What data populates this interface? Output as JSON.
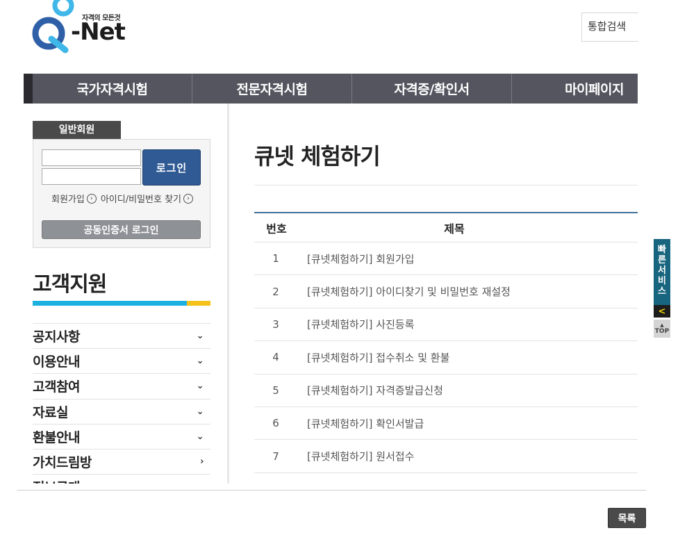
{
  "header": {
    "logo_tagline": "자격의 모든것",
    "logo_text": "-Net",
    "search_label": "통합검색"
  },
  "gnb": {
    "items": [
      {
        "label": "국가자격시험"
      },
      {
        "label": "전문자격시험"
      },
      {
        "label": "자격증/확인서"
      },
      {
        "label": "마이페이지"
      }
    ]
  },
  "login": {
    "tab_label": "일반회원",
    "id_value": "",
    "pw_value": "",
    "login_button": "로그인",
    "signup_link": "회원가입",
    "find_link": "아이디/비밀번호 찾기",
    "cert_button": "공동인증서 로그인"
  },
  "sidebar": {
    "title": "고객지원",
    "items": [
      {
        "label": "공지사항",
        "chevron": "⌄"
      },
      {
        "label": "이용안내",
        "chevron": "⌄"
      },
      {
        "label": "고객참여",
        "chevron": "⌄"
      },
      {
        "label": "자료실",
        "chevron": "⌄"
      },
      {
        "label": "환불안내",
        "chevron": "⌄"
      },
      {
        "label": "가치드림방",
        "chevron": "›"
      },
      {
        "label": "정보공개",
        "chevron": ""
      }
    ]
  },
  "main": {
    "title": "큐넷 체험하기",
    "table": {
      "header_num": "번호",
      "header_title": "제목",
      "rows": [
        {
          "num": "1",
          "title": "[큐넷체험하기] 회원가입"
        },
        {
          "num": "2",
          "title": "[큐넷체험하기] 아이디찾기 및 비밀번호 재설정"
        },
        {
          "num": "3",
          "title": "[큐넷체험하기] 사진등록"
        },
        {
          "num": "4",
          "title": "[큐넷체험하기] 접수취소 및 환불"
        },
        {
          "num": "5",
          "title": "[큐넷체험하기] 자격증발급신청"
        },
        {
          "num": "6",
          "title": "[큐넷체험하기] 확인서발급"
        },
        {
          "num": "7",
          "title": "[큐넷체험하기] 원서접수"
        }
      ]
    },
    "list_button": "목록"
  },
  "quick": {
    "label_chars": [
      "빠",
      "른",
      "서",
      "비",
      "스"
    ],
    "toggle": "<",
    "top_arrow": "▲",
    "top_label": "TOP"
  },
  "colors": {
    "gnb": "#555560",
    "login_button": "#2f5a93",
    "accent_blue": "#1bb0e0",
    "accent_yellow": "#f5c21b",
    "quick_panel": "#17657e"
  }
}
